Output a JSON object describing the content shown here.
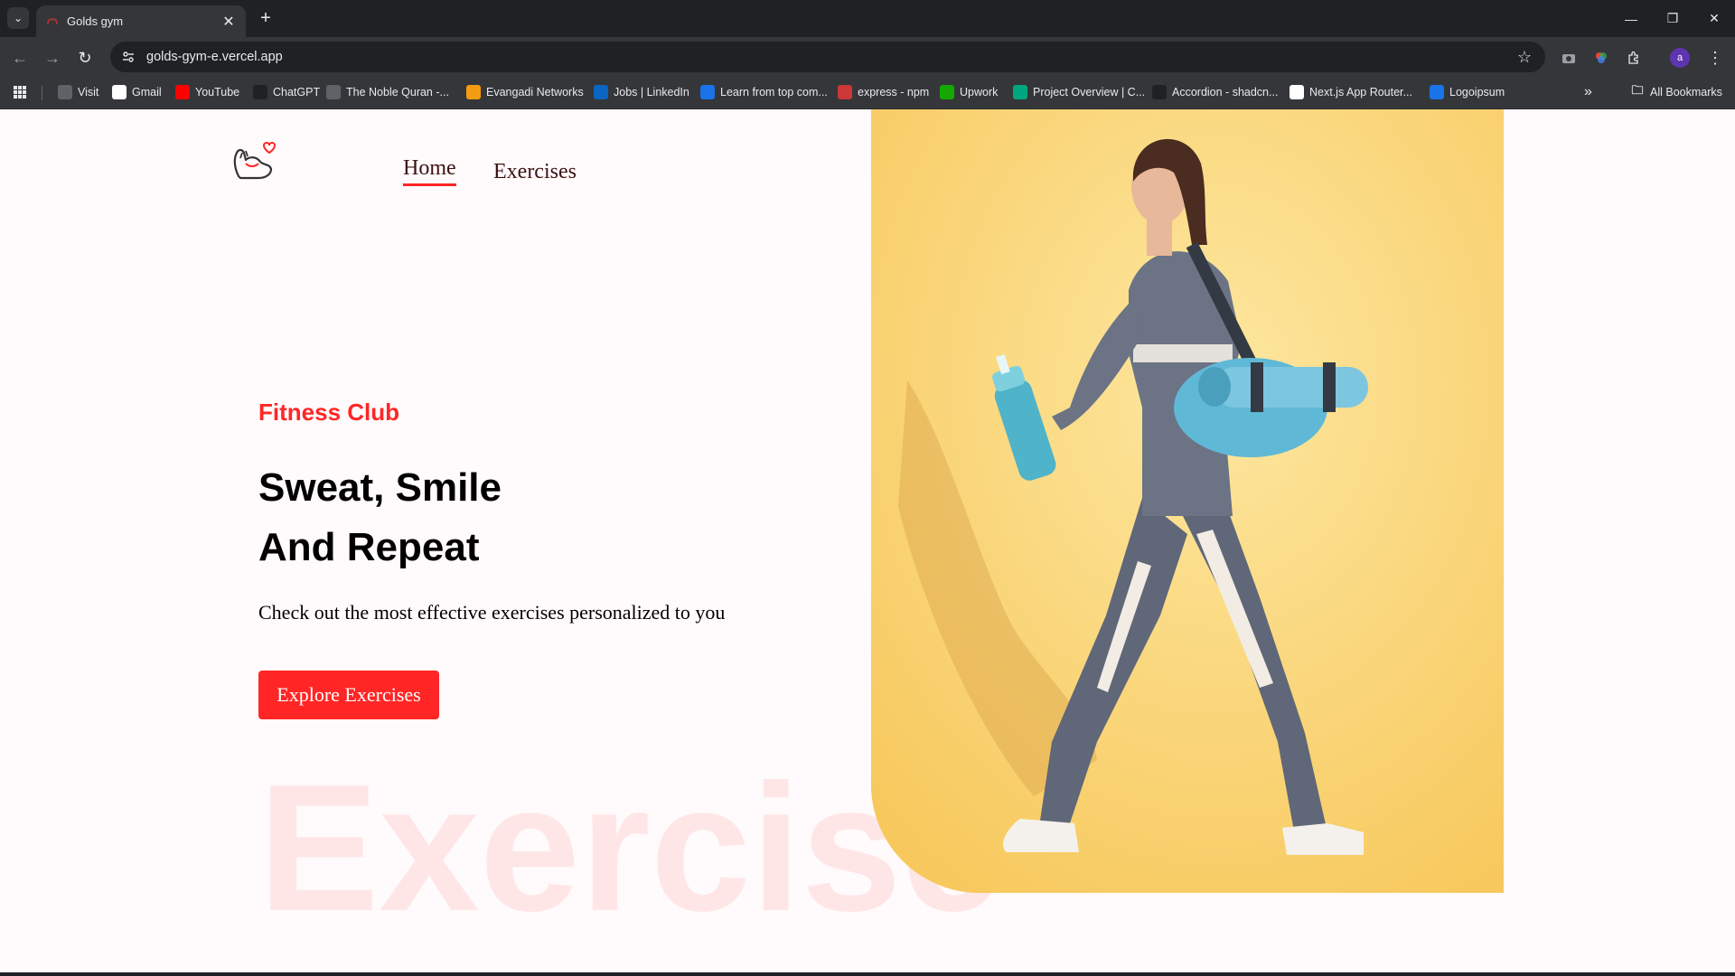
{
  "browser": {
    "tab_title": "Golds gym",
    "url": "golds-gym-e.vercel.app",
    "profile_initial": "a",
    "bookmarks": [
      {
        "label": "Visit",
        "icon": "globe-icon",
        "color": "#5f6368"
      },
      {
        "label": "Gmail",
        "icon": "google-icon",
        "color": "#ffffff"
      },
      {
        "label": "YouTube",
        "icon": "youtube-icon",
        "color": "#ff0000"
      },
      {
        "label": "ChatGPT",
        "icon": "chatgpt-icon",
        "color": "#202124"
      },
      {
        "label": "The Noble Quran -...",
        "icon": "quran-icon",
        "color": "#5f6368"
      },
      {
        "label": "Evangadi Networks",
        "icon": "evangadi-icon",
        "color": "#f39c12"
      },
      {
        "label": "Jobs | LinkedIn",
        "icon": "linkedin-icon",
        "color": "#0a66c2"
      },
      {
        "label": "Learn from top com...",
        "icon": "learn-icon",
        "color": "#1a73e8"
      },
      {
        "label": "express - npm",
        "icon": "npm-icon",
        "color": "#cb3837"
      },
      {
        "label": "Upwork",
        "icon": "upwork-icon",
        "color": "#14a800"
      },
      {
        "label": "Project Overview | C...",
        "icon": "project-icon",
        "color": "#00a67e"
      },
      {
        "label": "Accordion - shadcn...",
        "icon": "shadcn-icon",
        "color": "#202124"
      },
      {
        "label": "Next.js App Router...",
        "icon": "nextjs-icon",
        "color": "#ffffff"
      },
      {
        "label": "Logoipsum",
        "icon": "logoipsum-icon",
        "color": "#1a73e8"
      }
    ],
    "all_bookmarks": "All Bookmarks"
  },
  "nav": {
    "home": "Home",
    "exercises": "Exercises"
  },
  "hero": {
    "kicker": "Fitness Club",
    "headline_line1": "Sweat, Smile",
    "headline_line2": "And Repeat",
    "subtext": "Check out the most effective exercises personalized to you",
    "cta": "Explore Exercises",
    "watermark": "Exercise"
  },
  "colors": {
    "accent": "#ff2625",
    "page_bg": "#fffafb",
    "hero_bg": "#fbd46c"
  }
}
